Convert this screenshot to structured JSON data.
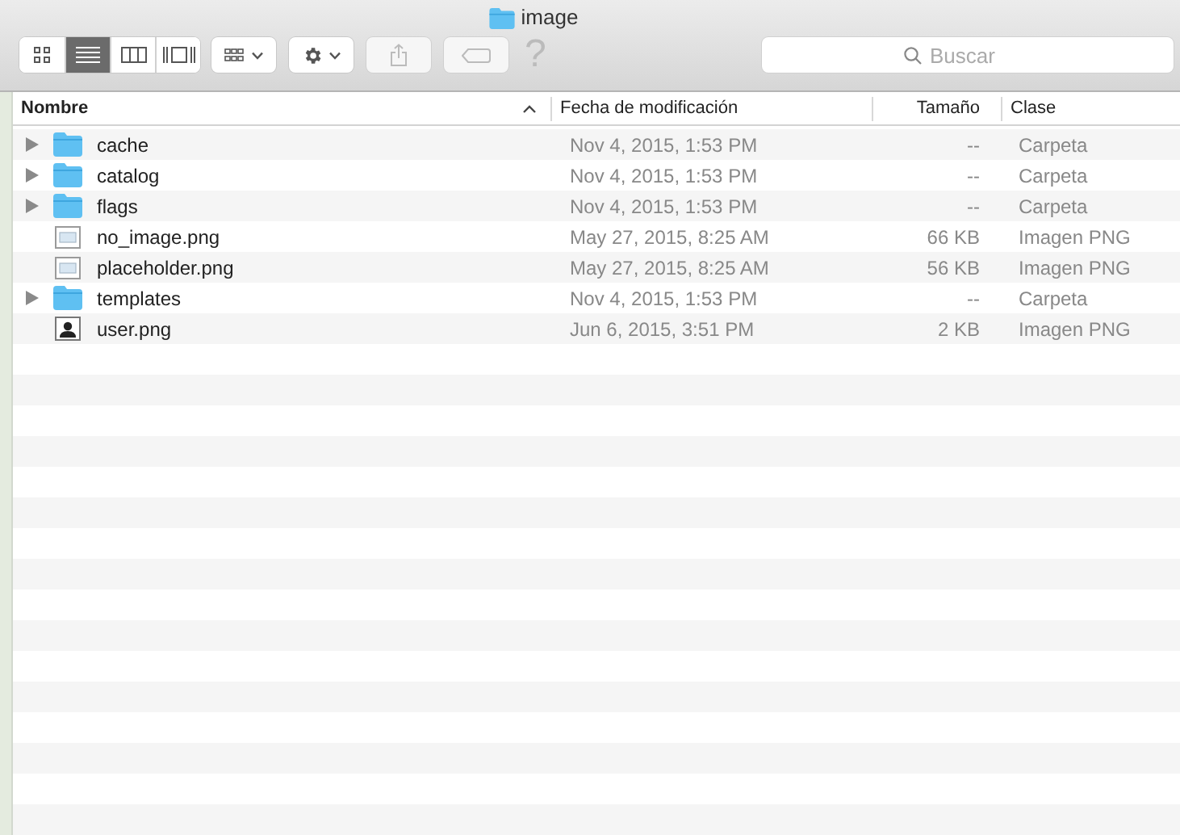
{
  "window": {
    "title": "image"
  },
  "view_buttons": [
    {
      "kind": "icons",
      "selected": false
    },
    {
      "kind": "list",
      "selected": true
    },
    {
      "kind": "columns",
      "selected": false
    },
    {
      "kind": "coverflow",
      "selected": false
    }
  ],
  "search": {
    "placeholder": "Buscar"
  },
  "help": "?",
  "table": {
    "columns": [
      {
        "label": "Nombre",
        "sorted": true
      },
      {
        "label": "Fecha de modificación",
        "sorted": false
      },
      {
        "label": "Tamaño",
        "sorted": false
      },
      {
        "label": "Clase",
        "sorted": false
      }
    ],
    "rows": [
      {
        "kind": "folder",
        "name": "cache",
        "date": "Nov 4, 2015, 1:53 PM",
        "size": "--",
        "type": "Carpeta"
      },
      {
        "kind": "folder",
        "name": "catalog",
        "date": "Nov 4, 2015, 1:53 PM",
        "size": "--",
        "type": "Carpeta"
      },
      {
        "kind": "folder",
        "name": "flags",
        "date": "Nov 4, 2015, 1:53 PM",
        "size": "--",
        "type": "Carpeta"
      },
      {
        "kind": "image",
        "name": "no_image.png",
        "date": "May 27, 2015, 8:25 AM",
        "size": "66 KB",
        "type": "Imagen PNG"
      },
      {
        "kind": "image",
        "name": "placeholder.png",
        "date": "May 27, 2015, 8:25 AM",
        "size": "56 KB",
        "type": "Imagen PNG"
      },
      {
        "kind": "folder",
        "name": "templates",
        "date": "Nov 4, 2015, 1:53 PM",
        "size": "--",
        "type": "Carpeta"
      },
      {
        "kind": "user",
        "name": "user.png",
        "date": "Jun 6, 2015, 3:51 PM",
        "size": "2 KB",
        "type": "Imagen PNG"
      }
    ]
  }
}
